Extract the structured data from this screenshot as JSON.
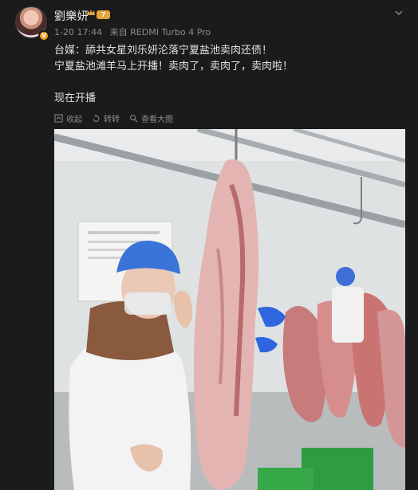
{
  "post": {
    "username": "劉樂妍",
    "level": "7",
    "date": "1-20 17:44",
    "source": "来自 REDMI Turbo 4 Pro",
    "lines": [
      "台媒：舔共女星刘乐妍沦落宁夏盐池卖肉还债！",
      "宁夏盐池滩羊马上开播！卖肉了，卖肉了，卖肉啦！",
      "",
      "现在开播"
    ]
  },
  "actions": {
    "collapse": "收起",
    "repost": "转转",
    "view_large": "查看大图"
  },
  "icons": {
    "verify": "verified-v-icon",
    "crown": "crown-icon",
    "chevron": "chevron-down-icon"
  },
  "colors": {
    "background": "#1b1b1b",
    "text": "#e2e2e2",
    "meta": "#8c8c8c",
    "badge": "#f59b1b"
  }
}
